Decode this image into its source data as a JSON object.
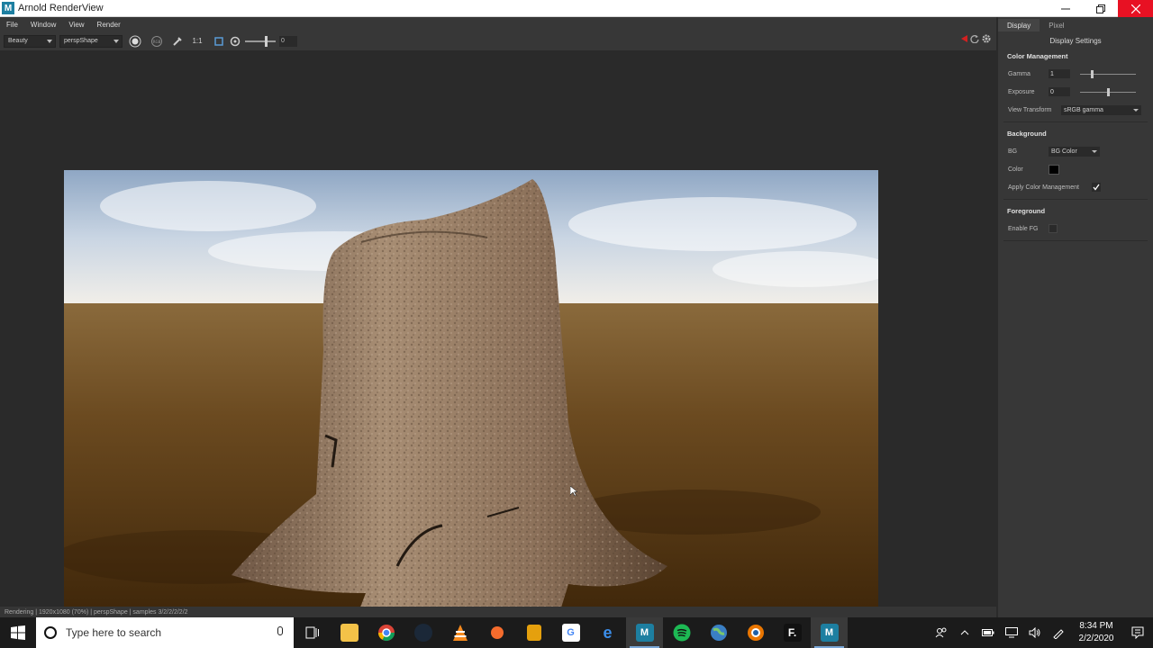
{
  "window": {
    "title": "Arnold RenderView",
    "app_icon": "M",
    "buttons": [
      "minimize-icon",
      "restore-icon",
      "close-icon"
    ]
  },
  "menu": [
    "File",
    "Window",
    "View",
    "Render"
  ],
  "toolbar": {
    "aov": "Beauty",
    "camera": "perspShape",
    "ratio": "1:1",
    "exposure_value": "0"
  },
  "render": {
    "status": "Rendering | 1920x1080 (70%) | perspShape  | samples 3/2/2/2/2/2"
  },
  "panel": {
    "tabs": [
      "Display",
      "Pixel"
    ],
    "heading": "Display Settings",
    "color_management": {
      "title": "Color Management",
      "gamma_label": "Gamma",
      "gamma_value": "1",
      "gamma_level": 0.25,
      "exposure_label": "Exposure",
      "exposure_value": "0",
      "exposure_level": 0.5,
      "view_transform_label": "View Transform",
      "view_transform_value": "sRGB gamma"
    },
    "background": {
      "title": "Background",
      "bg_label": "BG",
      "bg_value": "BG Color",
      "color_label": "Color",
      "color_value": "#000000",
      "apply_cm_label": "Apply Color Management",
      "apply_cm_checked": true
    },
    "foreground": {
      "title": "Foreground",
      "enable_fg_label": "Enable FG",
      "enable_fg_checked": false
    }
  },
  "taskbar": {
    "search_placeholder": "Type here to search",
    "apps": [
      "task-view",
      "file-explorer",
      "chrome",
      "steam",
      "vlc",
      "origin",
      "plex",
      "google",
      "edge",
      "maya",
      "spotify",
      "globe",
      "blender",
      "fusion",
      "maya"
    ],
    "time": "8:34 PM",
    "date": "2/2/2020"
  }
}
